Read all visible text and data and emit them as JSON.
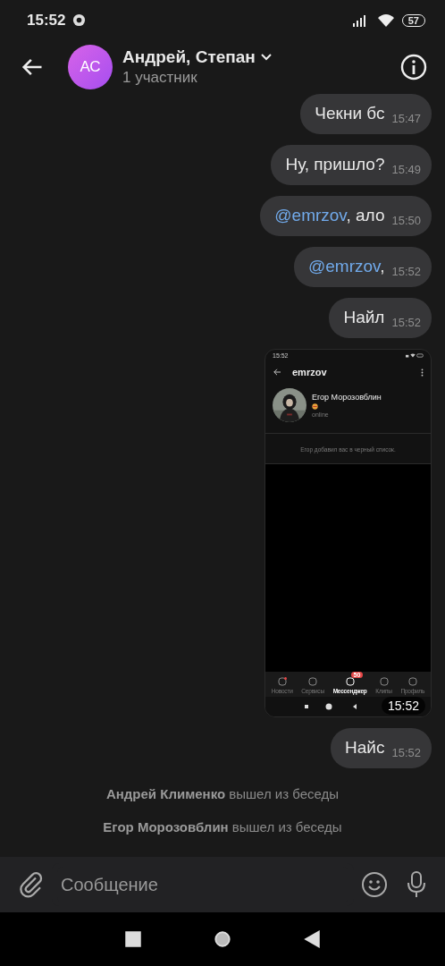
{
  "status_bar": {
    "time": "15:52",
    "battery": "57"
  },
  "header": {
    "avatar_initials": "АС",
    "title": "Андрей, Степан",
    "subtitle": "1 участник"
  },
  "messages": [
    {
      "kind": "text",
      "text": "Чекни бс",
      "time": "15:47"
    },
    {
      "kind": "text",
      "text": "Ну, пришло?",
      "time": "15:49"
    },
    {
      "kind": "text",
      "mention": "@emrzov",
      "text": ", ало",
      "time": "15:50"
    },
    {
      "kind": "text",
      "mention": "@emrzov",
      "text": ",",
      "time": "15:52"
    },
    {
      "kind": "text",
      "text": "Найл",
      "time": "15:52"
    },
    {
      "time": "15:52",
      "screenshot": {
        "time": "15:52",
        "title": "emrzov",
        "name": "Егор Морозовблин",
        "status": "online",
        "notice": "Егор добавил вас в черный список.",
        "tabs": [
          {
            "label": "Новости",
            "selected": false,
            "dot": true
          },
          {
            "label": "Сервисы",
            "selected": false
          },
          {
            "label": "Мессенджер",
            "selected": true,
            "badge": "50"
          },
          {
            "label": "Клипы",
            "selected": false
          },
          {
            "label": "Профиль",
            "selected": false
          }
        ]
      }
    },
    {
      "kind": "text",
      "text": "Найс",
      "time": "15:52"
    }
  ],
  "system_messages": [
    "**Андрей Клименко** вышел из беседы",
    "**Егор Морозовблин** вышел из беседы"
  ],
  "composer": {
    "placeholder": "Сообщение"
  }
}
